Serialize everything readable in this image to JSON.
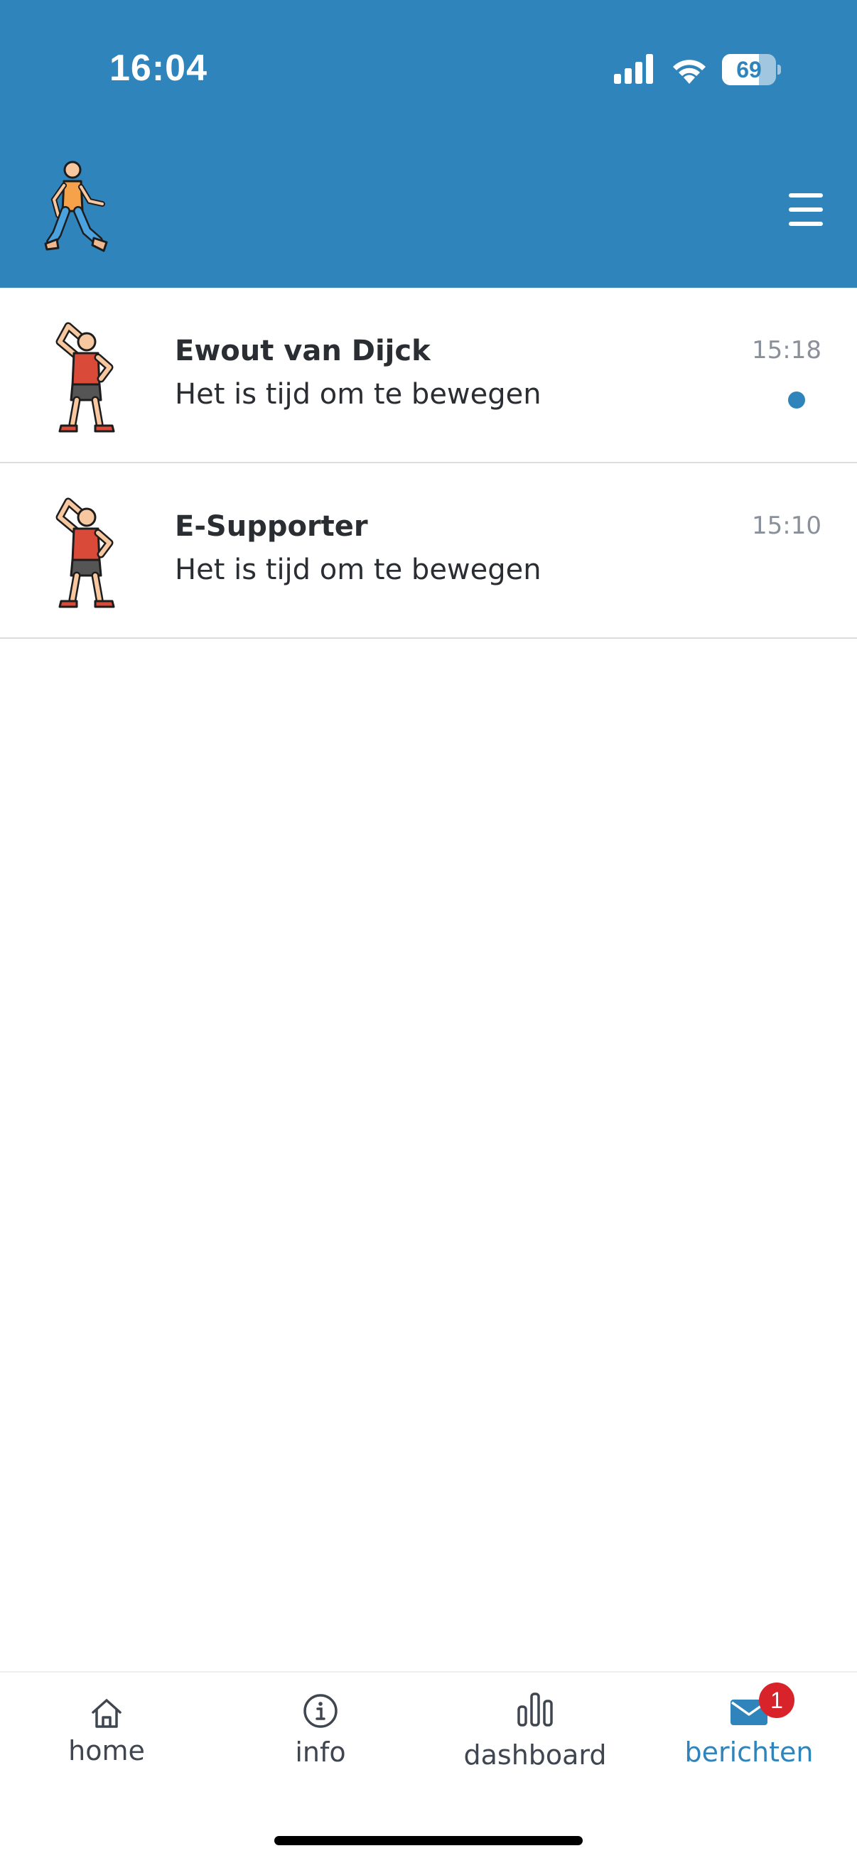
{
  "status_bar": {
    "time": "16:04",
    "battery_level": "69",
    "signal_icon": "cellular-signal-icon",
    "wifi_icon": "wifi-icon"
  },
  "header": {
    "logo_icon": "walking-person-logo",
    "menu_icon": "hamburger-menu-icon"
  },
  "messages": [
    {
      "sender": "Ewout van Dijck",
      "preview": "Het is tijd om te bewegen",
      "time": "15:18",
      "unread": true,
      "avatar_icon": "stretching-person-icon"
    },
    {
      "sender": "E-Supporter",
      "preview": "Het is tijd om te bewegen",
      "time": "15:10",
      "unread": false,
      "avatar_icon": "stretching-person-icon"
    }
  ],
  "nav": {
    "items": [
      {
        "label": "home",
        "icon": "home-icon",
        "active": false
      },
      {
        "label": "info",
        "icon": "info-icon",
        "active": false
      },
      {
        "label": "dashboard",
        "icon": "bar-chart-icon",
        "active": false
      },
      {
        "label": "berichten",
        "icon": "mail-icon",
        "active": true,
        "badge": "1"
      }
    ]
  },
  "colors": {
    "brand_blue": "#2f84bb",
    "badge_red": "#d8232a",
    "text_dark": "#2a2e33",
    "text_muted": "#8a9099"
  }
}
